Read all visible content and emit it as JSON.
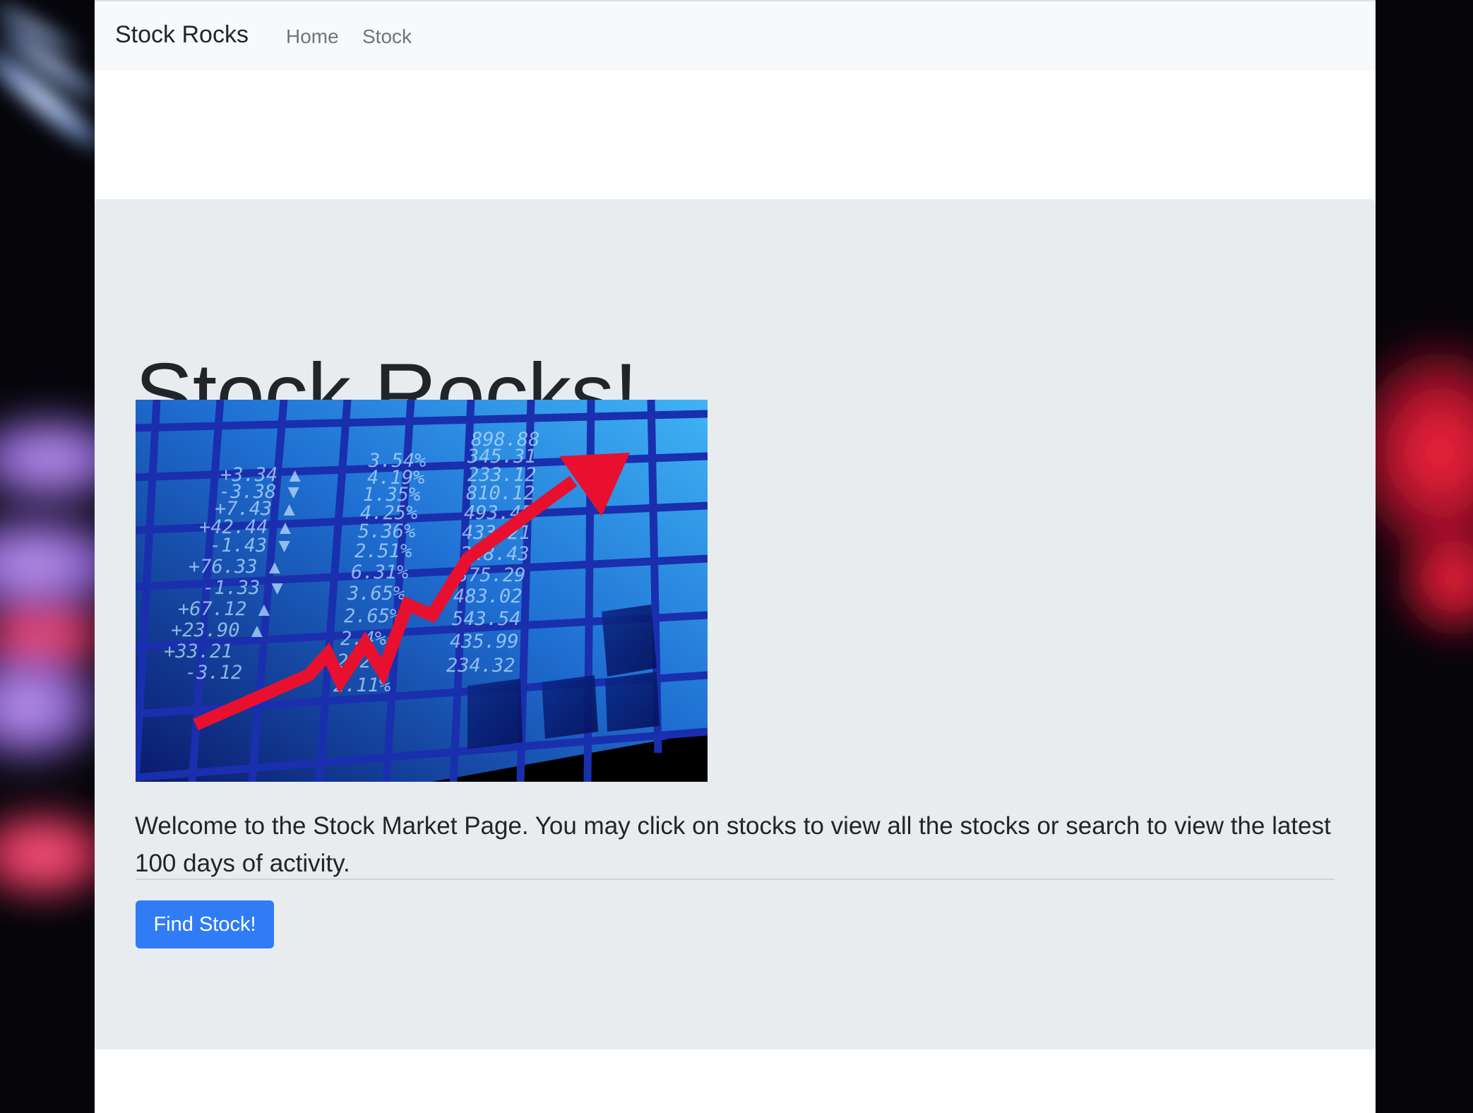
{
  "navbar": {
    "brand": "Stock Rocks",
    "links": [
      {
        "label": "Home"
      },
      {
        "label": "Stock"
      }
    ]
  },
  "hero": {
    "title": "Stock Rocks!",
    "image": {
      "ticker_left": [
        "+3.34",
        "-3.38",
        "+7.43",
        "+42.44",
        "-1.43",
        "+76.33",
        "-1.33",
        "+67.12",
        "+23.90",
        "+33.21",
        "-3.12"
      ],
      "ticker_mid": [
        "3.54%",
        "4.19%",
        "1.35%",
        "4.25%",
        "5.36%",
        "2.51%",
        "6.31%",
        "3.65%",
        "2.65%",
        "2.4%",
        "2.2%",
        "2.11%"
      ],
      "ticker_right": [
        "898.88",
        "345.31",
        "233.12",
        "810.12",
        "493.45",
        "433.21",
        "248.43",
        "375.29",
        "483.02",
        "543.54",
        "435.99",
        "234.32"
      ],
      "arrow_color": "#e8102e"
    },
    "lead": "Welcome to the Stock Market Page. You may click on stocks to view all the stocks or search to view the latest 100 days of activity.",
    "button_label": "Find Stock!"
  },
  "colors": {
    "primary": "#2f7cf6",
    "navbar_bg": "#f8f9fa",
    "jumbotron_bg": "#e9ecef",
    "text": "#212529",
    "nav_link": "#6c757d"
  }
}
